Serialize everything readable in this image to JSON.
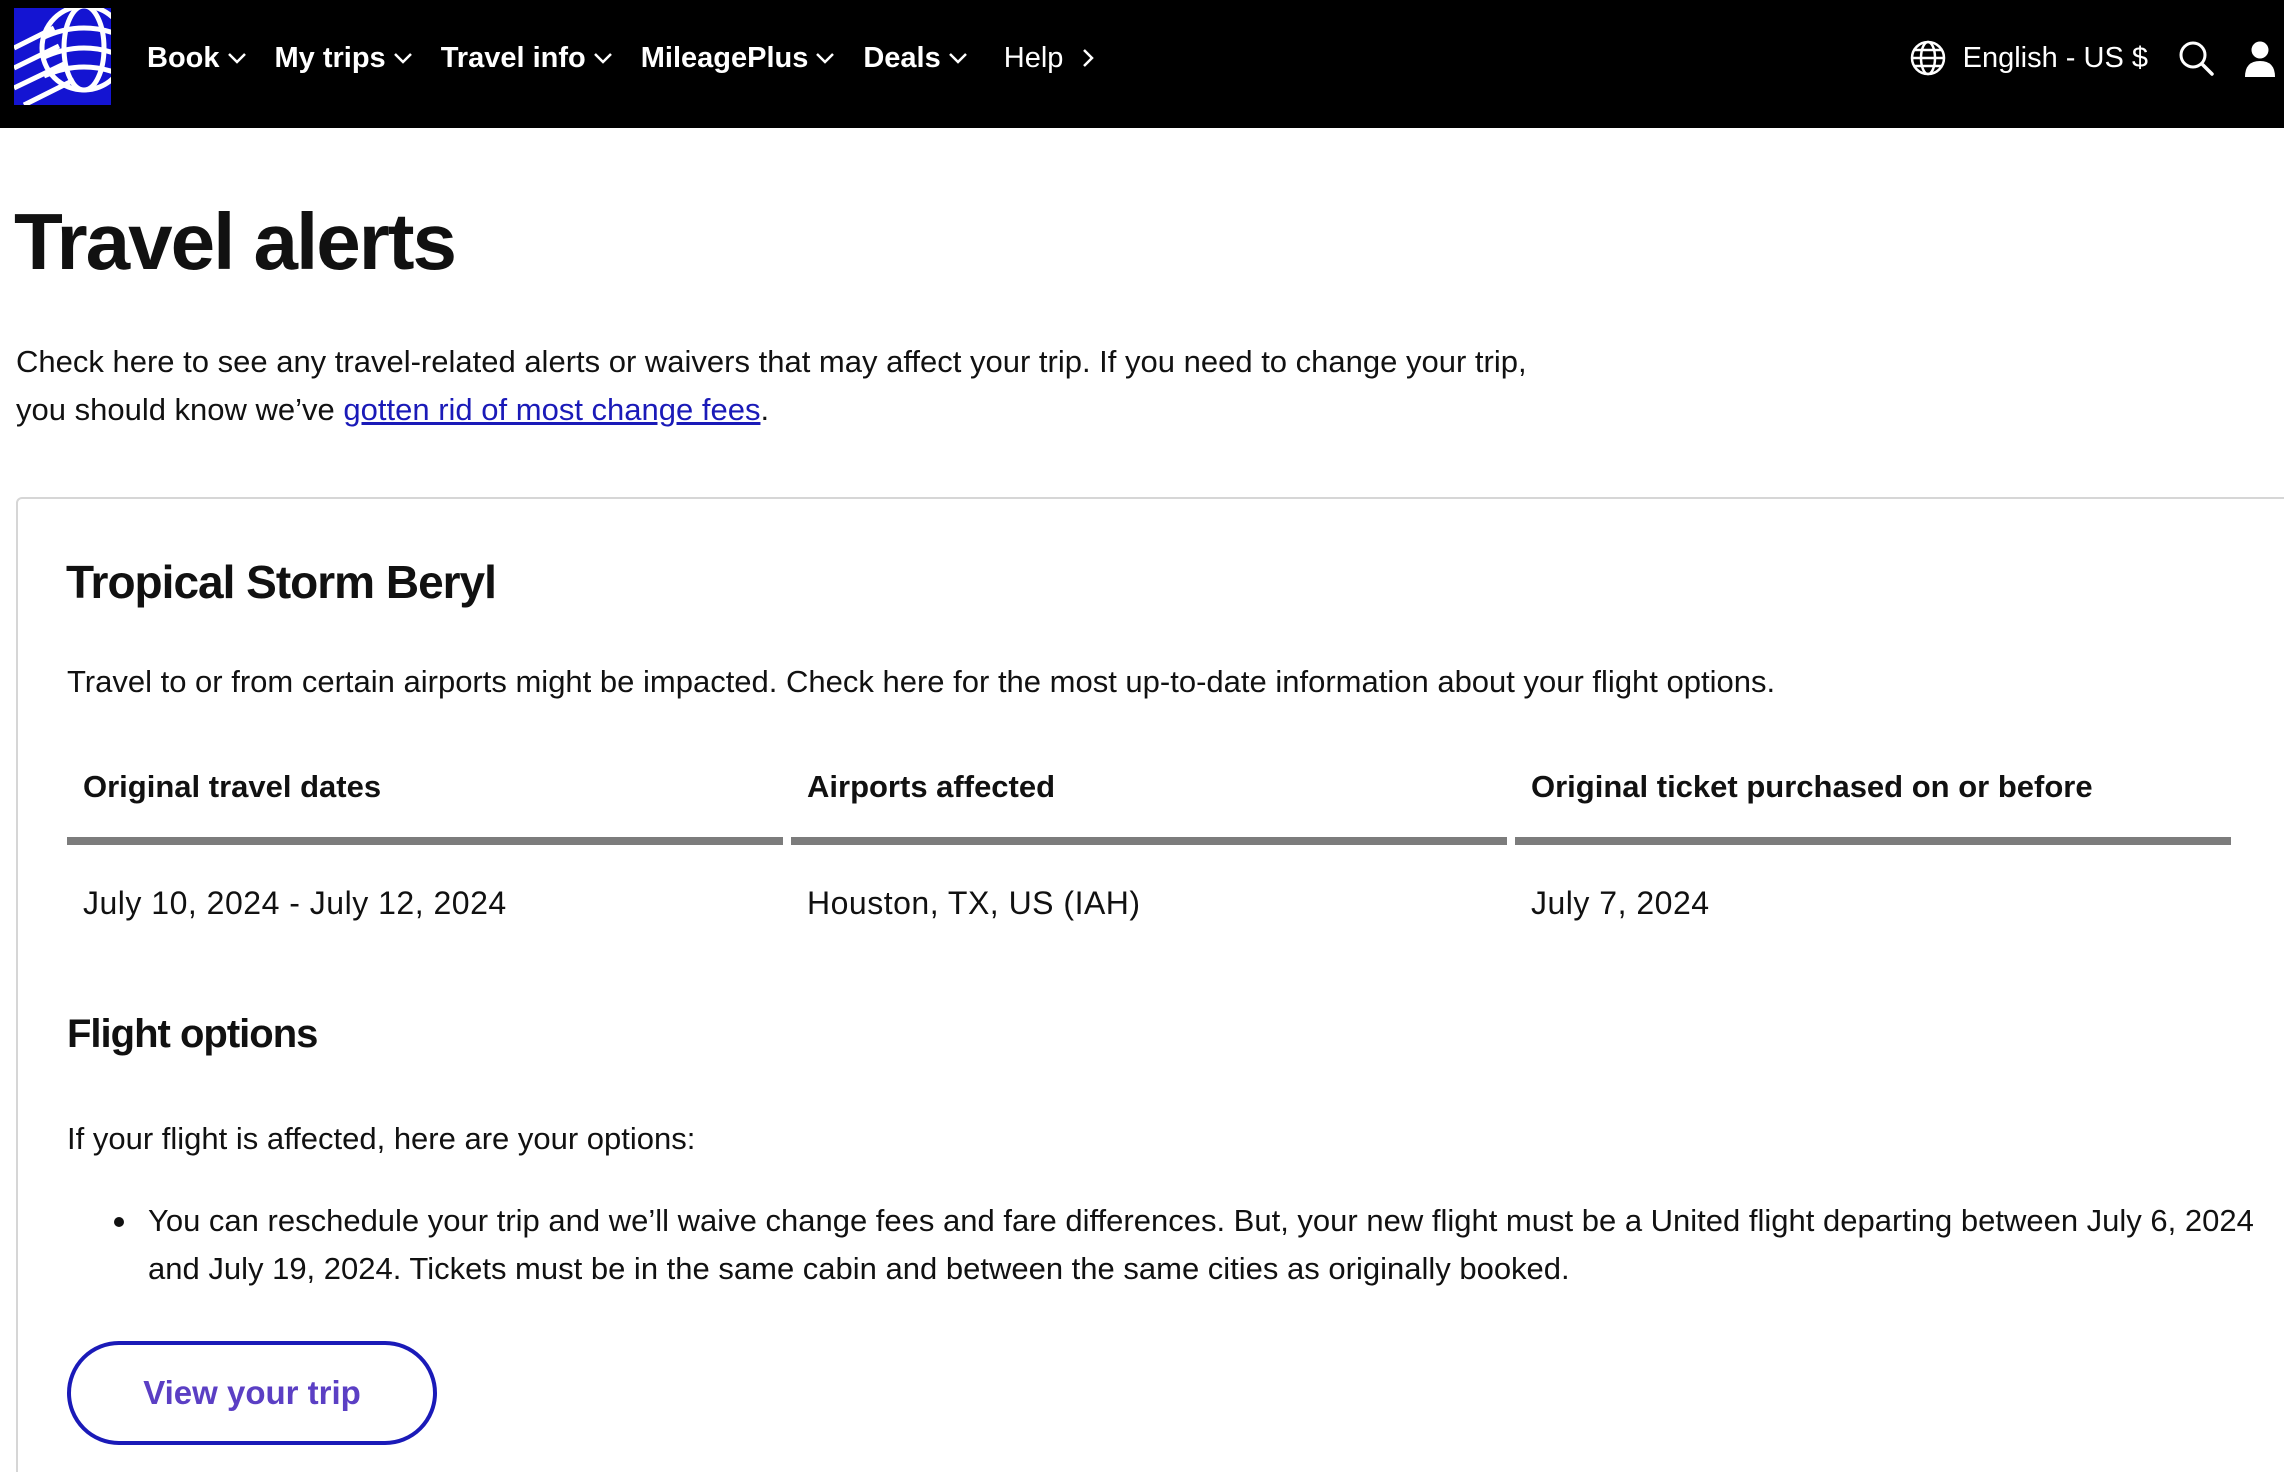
{
  "nav": {
    "items": [
      {
        "label": "Book"
      },
      {
        "label": "My trips"
      },
      {
        "label": "Travel info"
      },
      {
        "label": "MileagePlus"
      },
      {
        "label": "Deals"
      }
    ],
    "help_label": "Help",
    "language_label": "English - US $",
    "icons": [
      "united-globe-logo",
      "globe-icon",
      "search-icon",
      "user-icon"
    ]
  },
  "page": {
    "title": "Travel alerts",
    "intro_text": "Check here to see any travel-related alerts or waivers that may affect your trip. If you need to change your trip,",
    "intro_text_2": "you should know we’ve ",
    "intro_link": "gotten rid of most change fees",
    "intro_end": "."
  },
  "alert": {
    "title": "Tropical Storm Beryl",
    "description": "Travel to or from certain airports might be impacted. Check here for the most up-to-date information about your flight options.",
    "table": {
      "headers": [
        "Original travel dates",
        "Airports affected",
        "Original ticket purchased on or before"
      ],
      "row": [
        "July 10, 2024 - July 12, 2024",
        "Houston, TX, US (IAH)",
        "July 7, 2024"
      ]
    },
    "options_title": "Flight options",
    "options_intro": "If your flight is affected, here are your options:",
    "options": [
      "You can reschedule your trip and we’ll waive change fees and fare differences. But, your new flight must be a United flight departing between July 6, 2024 and July 19, 2024. Tickets must be in the same cabin and between the same cities as originally booked."
    ],
    "button_label": "View your trip"
  },
  "colors": {
    "nav_bg": "#000000",
    "logo_bg": "#1414d2",
    "link": "#1a1ab8",
    "button_text": "#5b3fc4",
    "table_rule": "#7c7c7c"
  }
}
